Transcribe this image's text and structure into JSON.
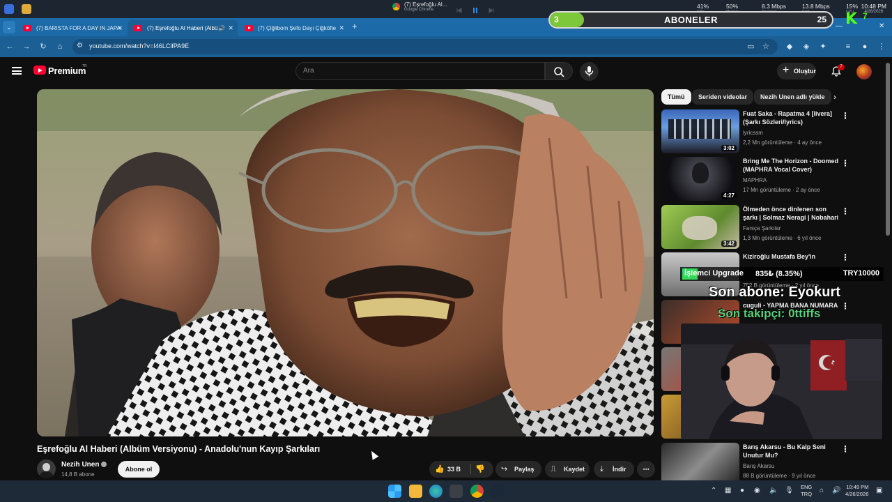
{
  "system_bar": {
    "media_title": "(7) Eşrefoğlu Al...",
    "media_app": "Google Chrome",
    "stats": [
      {
        "value": "41%",
        "label": "CPU"
      },
      {
        "value": "50%",
        "label": "Memory"
      },
      {
        "value": "8.3 Mbps",
        "label": "Received"
      },
      {
        "value": "13.8 Mbps",
        "label": "Sent"
      },
      {
        "value": "15%",
        "label": "GPU"
      }
    ],
    "time": "10:48 PM",
    "date": "4/26/2026"
  },
  "tabs": [
    {
      "title": "(7) BARISTA FOR A DAY IN JAPA",
      "active": false
    },
    {
      "title": "(7) Eşrefoğlu Al Haberi (Albü",
      "active": true
    },
    {
      "title": "(7) Çiğlibom Şefo Dayı Çiğköfte",
      "active": false
    }
  ],
  "address_bar": {
    "url": "youtube.com/watch?v=I46LCifPA9E"
  },
  "subscriber_goal": {
    "current": "3",
    "label": "ABONELER",
    "goal": "25",
    "progress": 0.12
  },
  "kick": {
    "logo": "K",
    "count": "7"
  },
  "youtube": {
    "brand": "Premium",
    "region": "TR",
    "search_placeholder": "Ara",
    "create_label": "Oluştur",
    "notif_count": "7"
  },
  "video": {
    "title": "Eşrefoğlu Al Haberi (Albüm Versiyonu) - Anadolu'nun Kayıp Şarkıları",
    "channel": "Nezih Unen",
    "subscribers": "14,8 B abone",
    "subscribe_label": "Abone ol",
    "likes": "33 B",
    "share_label": "Paylaş",
    "save_label": "Kaydet",
    "download_label": "İndir"
  },
  "chips": [
    "Tümü",
    "Seriden videolar",
    "Nezih Unen adlı yükle"
  ],
  "recommendations": [
    {
      "title": "Fuat Saka - Rapatma 4 [livera] (Şarkı Sözleri/lyrics)",
      "channel": "lyricssm",
      "meta": "2,2 Mn görüntüleme · 4 ay önce",
      "duration": "3:02"
    },
    {
      "title": "Bring Me The Horizon - Doomed (MAPHRA Vocal Cover)",
      "channel": "MAPHRA",
      "meta": "17 Mn görüntüleme · 2 ay önce",
      "duration": "4:27"
    },
    {
      "title": "Ölmeden önce dinlenen son şarkı | Solmaz Neragi | Nobahari",
      "channel": "Farsça Şarkılar",
      "meta": "1,3 Mn görüntüleme · 6 yıl önce",
      "duration": "3:42"
    },
    {
      "title": "Kiziroğlu Mustafa Bey'in",
      "channel": "",
      "meta": "752 B görüntüleme · 2 yıl önce",
      "duration": ""
    },
    {
      "title": "cuguli - YAPMA BANA NUMARA",
      "channel": "",
      "meta": "",
      "duration": ""
    },
    {
      "title": "Barış Akarsu - Bu Kalp Seni Unutur Mu?",
      "channel": "Barış Akarsu",
      "meta": "88 B görüntüleme · 9 yıl önce",
      "duration": ""
    }
  ],
  "stream_overlay": {
    "cpu_label": "İşlemci Upgrade",
    "cpu_value": "835₺ (8.35%)",
    "target": "TRY10000",
    "last_sub": "Son abone: Eyokurt",
    "last_follower": "Son takipçi: 0ttiffs"
  },
  "taskbar": {
    "lang": "ENG",
    "lang2": "TRQ",
    "time": "10:49 PM",
    "date": "4/26/2026"
  }
}
